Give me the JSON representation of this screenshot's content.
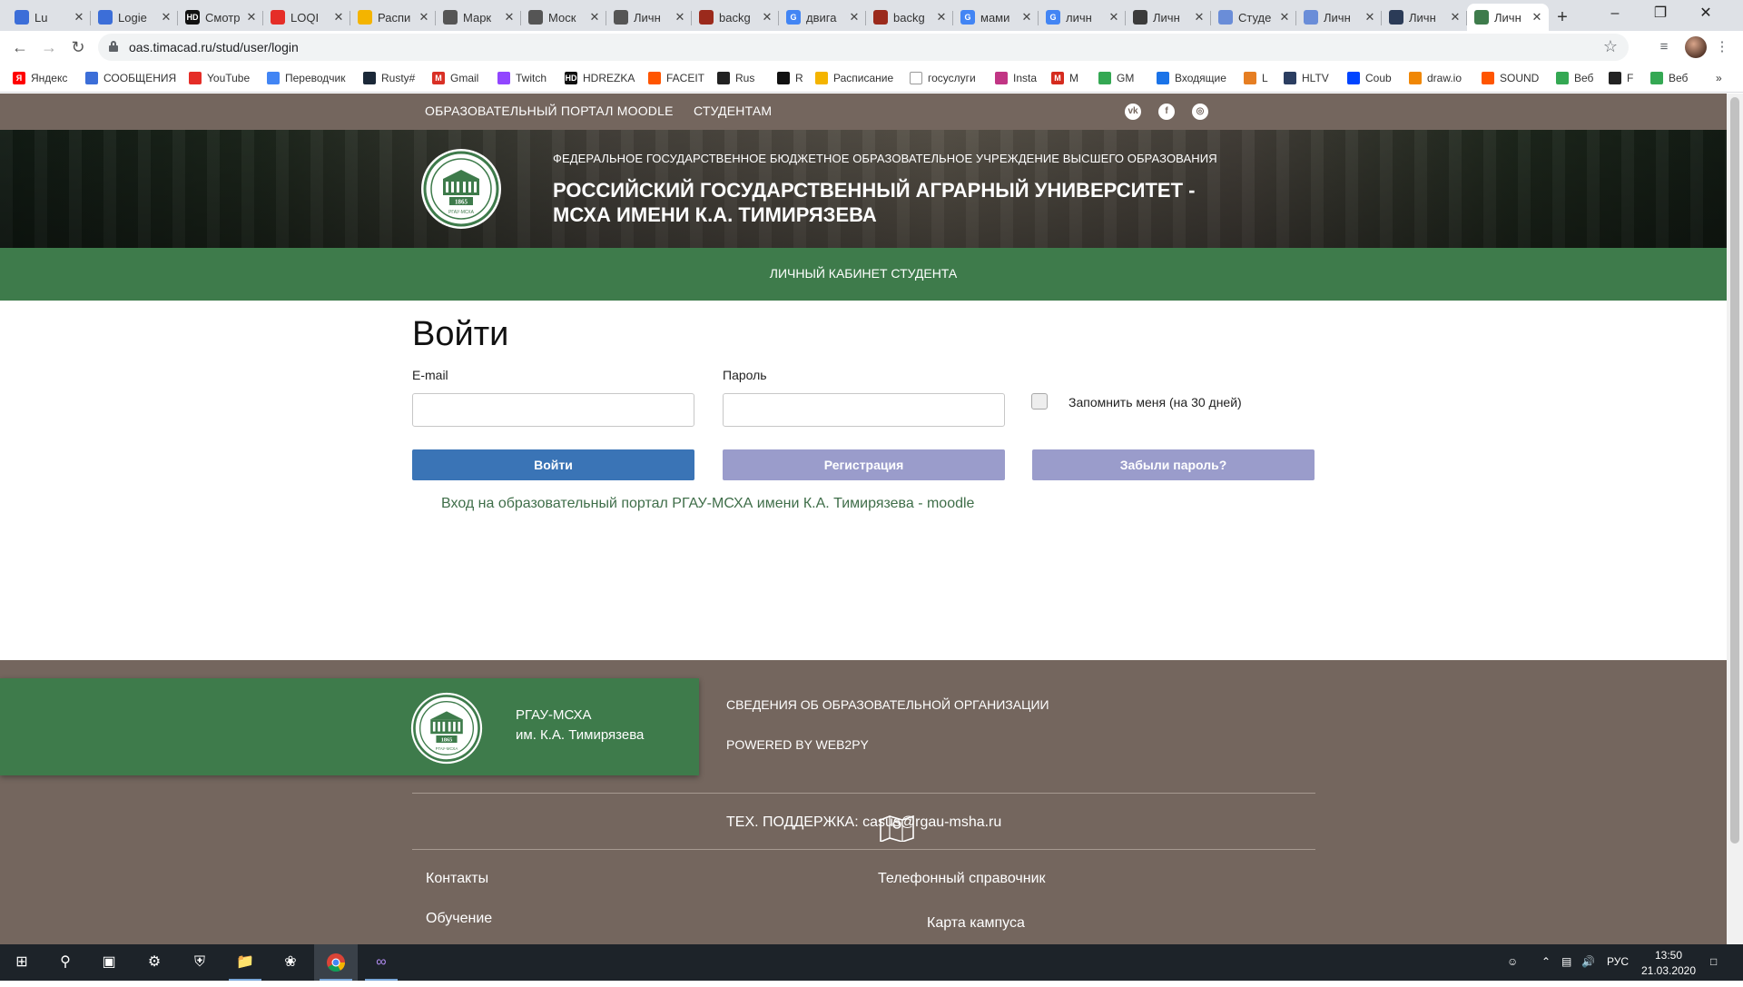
{
  "browser": {
    "tabs": [
      {
        "title": "Lu",
        "fav_color": "#3c6ed8",
        "fav_glyph": ""
      },
      {
        "title": "Logie",
        "fav_color": "#3c6ed8",
        "fav_glyph": ""
      },
      {
        "title": "Смотр",
        "fav_color": "#111111",
        "fav_glyph": "HD"
      },
      {
        "title": "LOQI",
        "fav_color": "#e52d27",
        "fav_glyph": ""
      },
      {
        "title": "Распи",
        "fav_color": "#f4b400",
        "fav_glyph": ""
      },
      {
        "title": "Марк",
        "fav_color": "#555555",
        "fav_glyph": ""
      },
      {
        "title": "Моск",
        "fav_color": "#555555",
        "fav_glyph": ""
      },
      {
        "title": "Личн",
        "fav_color": "#555555",
        "fav_glyph": ""
      },
      {
        "title": "backg",
        "fav_color": "#9b2a1c",
        "fav_glyph": ""
      },
      {
        "title": "двига",
        "fav_color": "#4285f4",
        "fav_glyph": "G"
      },
      {
        "title": "backg",
        "fav_color": "#9b2a1c",
        "fav_glyph": ""
      },
      {
        "title": "мами",
        "fav_color": "#4285f4",
        "fav_glyph": "G"
      },
      {
        "title": "личн",
        "fav_color": "#4285f4",
        "fav_glyph": "G"
      },
      {
        "title": "Личн",
        "fav_color": "#3b3b3b",
        "fav_glyph": ""
      },
      {
        "title": "Студе",
        "fav_color": "#6a8dd8",
        "fav_glyph": ""
      },
      {
        "title": "Личн",
        "fav_color": "#6a8dd8",
        "fav_glyph": ""
      },
      {
        "title": "Личн",
        "fav_color": "#2b3b57",
        "fav_glyph": ""
      },
      {
        "title": "Личн",
        "fav_color": "#3e7b4b",
        "fav_glyph": "",
        "active": true
      }
    ],
    "url": "oas.timacad.ru/stud/user/login",
    "bookmarks": [
      {
        "label": "Яндекс",
        "color": "#ff0000",
        "glyph": "Я"
      },
      {
        "label": "СООБЩЕНИЯ",
        "color": "#3c6ed8",
        "glyph": ""
      },
      {
        "label": "YouTube",
        "color": "#e52d27",
        "glyph": ""
      },
      {
        "label": "Переводчик",
        "color": "#4285f4",
        "glyph": ""
      },
      {
        "label": "Rusty#",
        "color": "#1b2838",
        "glyph": ""
      },
      {
        "label": "Gmail",
        "color": "#d93025",
        "glyph": "M"
      },
      {
        "label": "Twitch",
        "color": "#9146ff",
        "glyph": ""
      },
      {
        "label": "HDREZKA",
        "color": "#111111",
        "glyph": "HD"
      },
      {
        "label": "FACEIT",
        "color": "#ff5500",
        "glyph": ""
      },
      {
        "label": "Rus",
        "color": "#222222",
        "glyph": ""
      },
      {
        "label": "R",
        "color": "#111111",
        "glyph": ""
      },
      {
        "label": "Расписание",
        "color": "#f4b400",
        "glyph": ""
      },
      {
        "label": "госуслуги",
        "color": "#ffffff",
        "glyph": ""
      },
      {
        "label": "Insta",
        "color": "#c13584",
        "glyph": ""
      },
      {
        "label": "M",
        "color": "#d52b1e",
        "glyph": "M"
      },
      {
        "label": "GM",
        "color": "#34a853",
        "glyph": ""
      },
      {
        "label": "Входящие",
        "color": "#1a73e8",
        "glyph": ""
      },
      {
        "label": "L",
        "color": "#e67e22",
        "glyph": ""
      },
      {
        "label": "HLTV",
        "color": "#2b3e61",
        "glyph": ""
      },
      {
        "label": "Coub",
        "color": "#0044ff",
        "glyph": ""
      },
      {
        "label": "draw.io",
        "color": "#f08705",
        "glyph": ""
      },
      {
        "label": "SOUND",
        "color": "#ff5500",
        "glyph": ""
      },
      {
        "label": "Веб",
        "color": "#34a853",
        "glyph": ""
      },
      {
        "label": "F",
        "color": "#222222",
        "glyph": ""
      },
      {
        "label": "Веб",
        "color": "#34a853",
        "glyph": ""
      }
    ],
    "more_bookmarks": "»"
  },
  "site": {
    "topnav": {
      "moodle": "ОБРАЗОВАТЕЛЬНЫЙ ПОРТАЛ MOODLE",
      "students": "СТУДЕНТАМ"
    },
    "social": {
      "vk": "vk",
      "facebook": "f",
      "instagram": "◎"
    },
    "header": {
      "subtitle": "ФЕДЕРАЛЬНОЕ ГОСУДАРСТВЕННОЕ БЮДЖЕТНОЕ ОБРАЗОВАТЕЛЬНОЕ УЧРЕЖДЕНИЕ ВЫСШЕГО ОБРАЗОВАНИЯ",
      "title": "РОССИЙСКИЙ ГОСУДАРСТВЕННЫЙ АГРАРНЫЙ УНИВЕРСИТЕТ - МСХА ИМЕНИ К.А. ТИМИРЯЗЕВА",
      "logo_year": "1865",
      "logo_text": "РГАУ-МСХА"
    },
    "section_title": "ЛИЧНЫЙ КАБИНЕТ СТУДЕНТА",
    "login": {
      "heading": "Войти",
      "email_label": "E-mail",
      "email_value": "",
      "password_label": "Пароль",
      "password_value": "",
      "remember_label": "Запомнить меня (на 30 дней)",
      "remember_checked": false,
      "login_button": "Войти",
      "register_button": "Регистрация",
      "forgot_button": "Забыли пароль?",
      "moodle_link": "Вход на образовательный портал РГАУ-МСХА имени К.А. Тимирязева - moodle"
    },
    "footer": {
      "org_line1": "РГАУ-МСХА",
      "org_line2": "им. К.А. Тимирязева",
      "info_link": "СВЕДЕНИЯ ОБ ОБРАЗОВАТЕЛЬНОЙ ОРГАНИЗАЦИИ",
      "powered": "POWERED BY WEB2PY",
      "support": "ТЕХ. ПОДДЕРЖКА: casus@rgau-msha.ru",
      "contacts": "Контакты",
      "phonebook": "Телефонный справочник",
      "education": "Обучение",
      "campus_map": "Карта кампуса"
    }
  },
  "taskbar": {
    "language": "РУС",
    "time": "13:50",
    "date": "21.03.2020"
  }
}
